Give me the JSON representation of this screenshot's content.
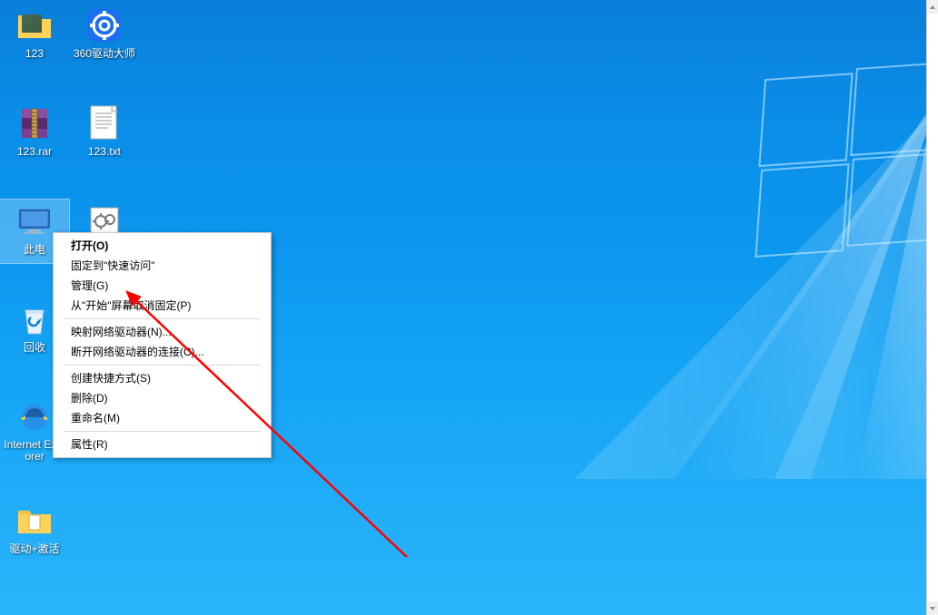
{
  "desktop": {
    "icons": [
      {
        "id": "folder-123",
        "label": "123"
      },
      {
        "id": "driver-master",
        "label": "360驱动大师"
      },
      {
        "id": "rar-123",
        "label": "123.rar"
      },
      {
        "id": "txt-123",
        "label": "123.txt"
      },
      {
        "id": "this-pc",
        "label": "此电"
      },
      {
        "id": "gear-file",
        "label": ""
      },
      {
        "id": "recycle-bin",
        "label": "回收"
      },
      {
        "id": "ie",
        "label": "Internet Explorer"
      },
      {
        "id": "driver-activate",
        "label": "驱动+激活"
      }
    ]
  },
  "context_menu": {
    "items": [
      {
        "label": "打开(O)",
        "bold": true
      },
      {
        "label": "固定到\"快速访问\"",
        "bold": false
      },
      {
        "label": "管理(G)",
        "bold": false
      },
      {
        "label": "从\"开始\"屏幕取消固定(P)",
        "bold": false
      }
    ],
    "items2": [
      {
        "label": "映射网络驱动器(N)...",
        "bold": false
      },
      {
        "label": "断开网络驱动器的连接(C)...",
        "bold": false
      }
    ],
    "items3": [
      {
        "label": "创建快捷方式(S)",
        "bold": false
      },
      {
        "label": "删除(D)",
        "bold": false
      },
      {
        "label": "重命名(M)",
        "bold": false
      }
    ],
    "items4": [
      {
        "label": "属性(R)",
        "bold": false
      }
    ]
  },
  "annotation": {
    "arrow_color": "#ff0000"
  }
}
